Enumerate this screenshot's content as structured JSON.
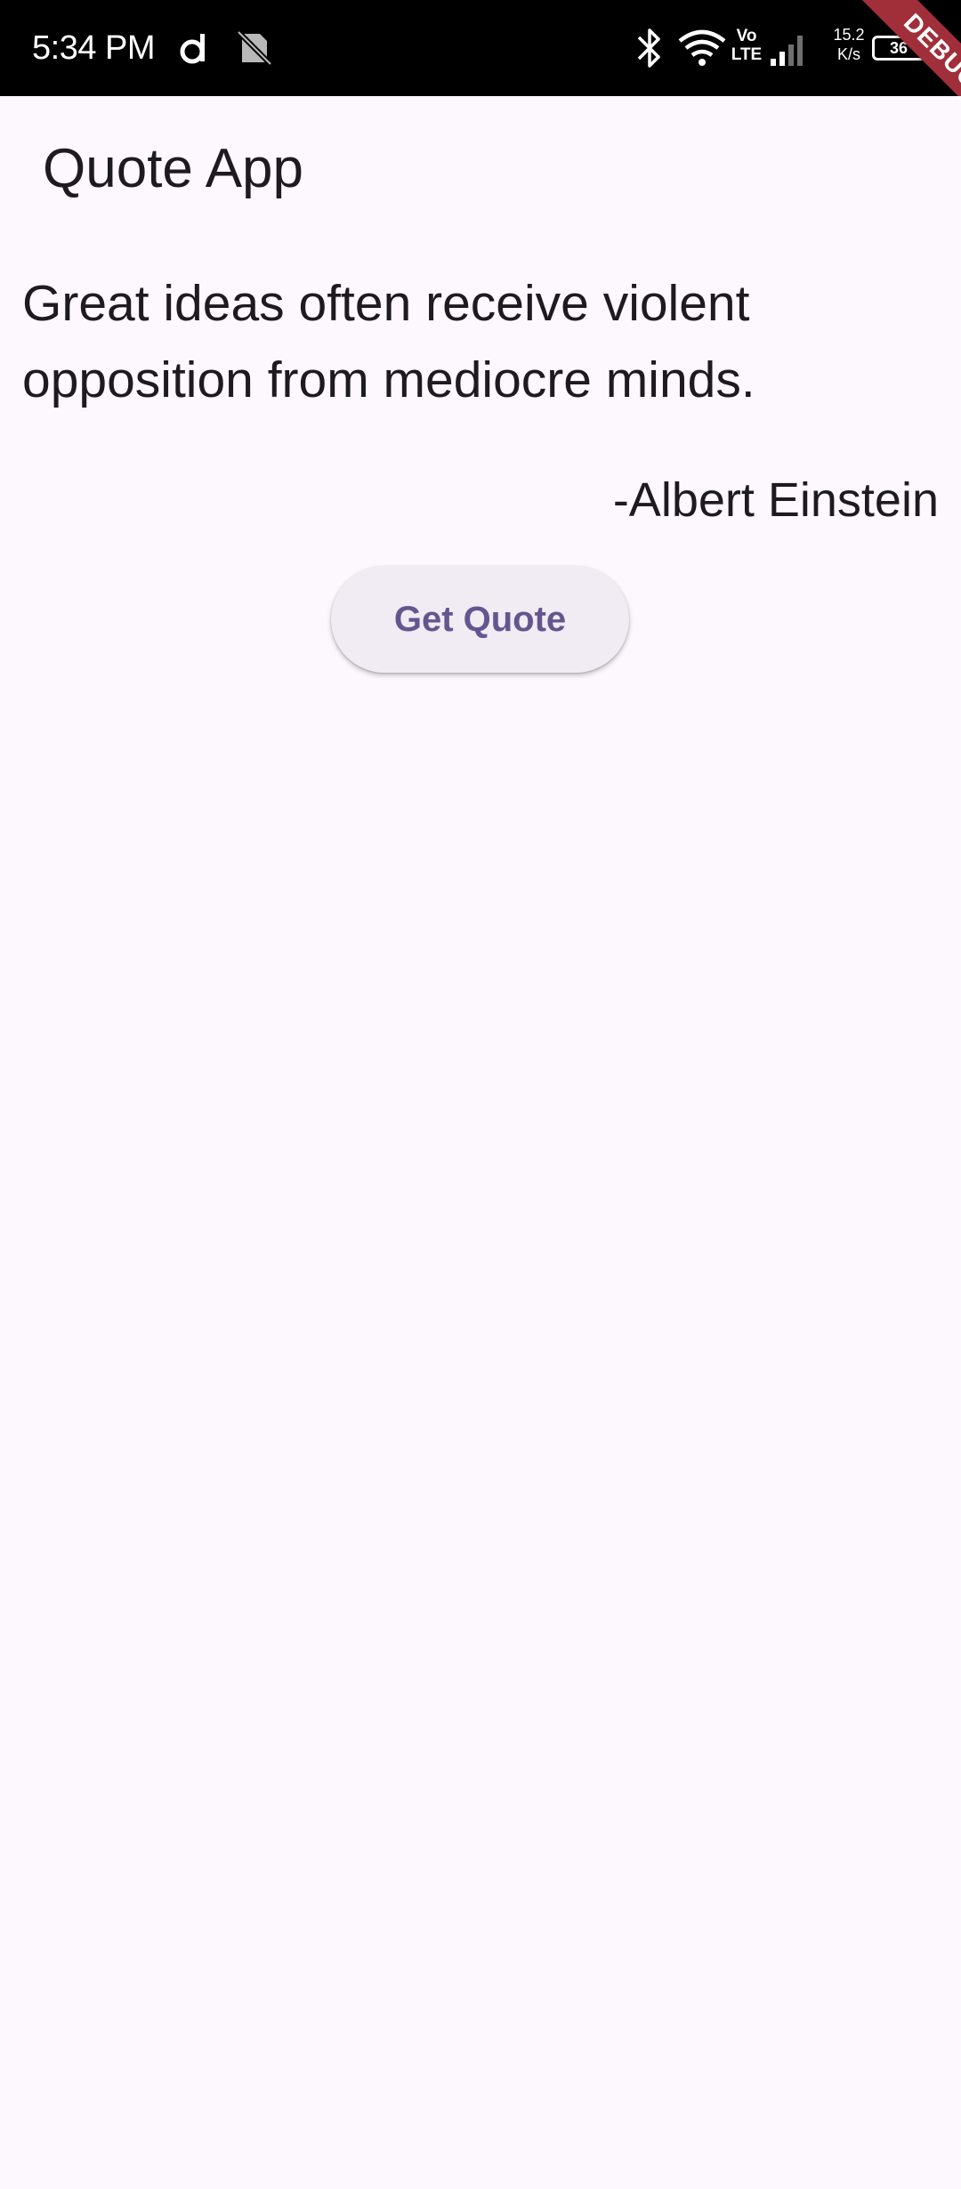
{
  "status_bar": {
    "time": "5:34 PM",
    "network_speed": "15.2\nK/s",
    "network_speed_value": "15.2",
    "network_speed_unit": "K/s",
    "battery_level": "36",
    "signal_label_top": "Vo",
    "signal_label_bottom": "LTE",
    "icons": [
      "d-app-icon",
      "no-sync-icon",
      "bluetooth-icon",
      "wifi-icon",
      "volte-icon",
      "cellular-signal-icon",
      "battery-icon"
    ]
  },
  "debug_banner": {
    "label": "DEBUG",
    "color": "#a02f3a"
  },
  "app_bar": {
    "title": "Quote App"
  },
  "quote": {
    "text": "Great ideas often receive violent opposition from mediocre minds.",
    "author": "-Albert Einstein"
  },
  "actions": {
    "get_quote_label": "Get Quote"
  },
  "colors": {
    "background": "#fdf8fd",
    "primary": "#65558f",
    "button_surface": "#f1ebf4",
    "text": "#1d1b20"
  }
}
